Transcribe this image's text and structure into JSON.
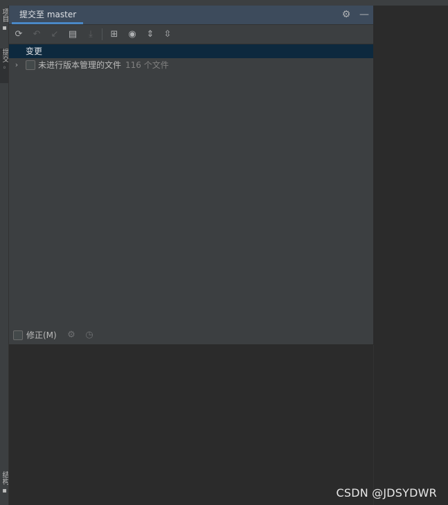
{
  "panel": {
    "title": "提交至 master",
    "settings_icon": "gear-icon",
    "minimize_icon": "minimize-icon"
  },
  "side_tabs": {
    "top": "项目",
    "active": "提交",
    "bottom": "结构"
  },
  "toolbar": {
    "buttons": [
      {
        "icon": "refresh-icon",
        "glyph": "⟳",
        "enabled": true
      },
      {
        "icon": "rollback-icon",
        "glyph": "↶",
        "enabled": false
      },
      {
        "icon": "update-icon",
        "glyph": "↙",
        "enabled": false
      },
      {
        "icon": "show-diff-icon",
        "glyph": "▤",
        "enabled": true
      },
      {
        "icon": "shelve-icon",
        "glyph": "⤓",
        "enabled": false
      },
      {
        "icon": "group-by-icon",
        "glyph": "⊞",
        "enabled": true
      },
      {
        "icon": "view-options-icon",
        "glyph": "◉",
        "enabled": true
      },
      {
        "icon": "expand-all-icon",
        "glyph": "⇕",
        "enabled": true
      },
      {
        "icon": "collapse-all-icon",
        "glyph": "⇳",
        "enabled": true
      }
    ]
  },
  "changes": {
    "header": "变更",
    "groups": [
      {
        "label": "未进行版本管理的文件",
        "count": "116 个文件",
        "checked": false,
        "expanded": false
      }
    ]
  },
  "commit": {
    "amend_label": "修正(M)",
    "amend_checked": false
  },
  "watermark": "CSDN @JDSYDWR"
}
